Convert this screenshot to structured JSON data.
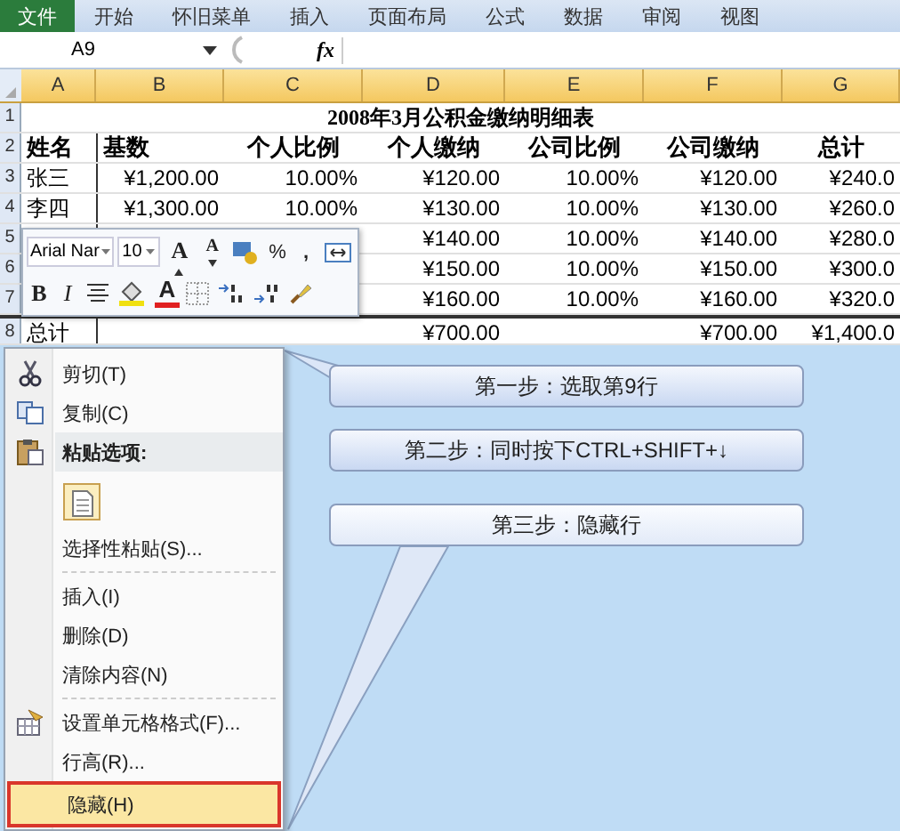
{
  "ribbon_tabs": [
    {
      "label": "文件",
      "selected": true
    },
    {
      "label": "开始",
      "selected": false
    },
    {
      "label": "怀旧菜单",
      "selected": false
    },
    {
      "label": "插入",
      "selected": false
    },
    {
      "label": "页面布局",
      "selected": false
    },
    {
      "label": "公式",
      "selected": false
    },
    {
      "label": "数据",
      "selected": false
    },
    {
      "label": "审阅",
      "selected": false
    },
    {
      "label": "视图",
      "selected": false
    }
  ],
  "formula_bar": {
    "name_box": "A9",
    "function_label": "fx"
  },
  "columns": [
    "A",
    "B",
    "C",
    "D",
    "E",
    "F",
    "G"
  ],
  "sheet": {
    "title_row": "1",
    "title": "2008年3月公积金缴纳明细表",
    "header_row": {
      "row": "2",
      "cells": [
        "姓名",
        "基数",
        "个人比例",
        "个人缴纳",
        "公司比例",
        "公司缴纳",
        "总计"
      ]
    },
    "rows": [
      {
        "row": "3",
        "kind": "data",
        "cells": [
          "张三",
          "¥1,200.00",
          "10.00%",
          "¥120.00",
          "10.00%",
          "¥120.00",
          "¥240.0"
        ]
      },
      {
        "row": "4",
        "kind": "data",
        "cells": [
          "李四",
          "¥1,300.00",
          "10.00%",
          "¥130.00",
          "10.00%",
          "¥130.00",
          "¥260.0"
        ]
      },
      {
        "row": "5",
        "kind": "data",
        "cells": [
          null,
          null,
          null,
          "¥140.00",
          "10.00%",
          "¥140.00",
          "¥280.0"
        ]
      },
      {
        "row": "6",
        "kind": "data",
        "cells": [
          null,
          null,
          null,
          "¥150.00",
          "10.00%",
          "¥150.00",
          "¥300.0"
        ]
      },
      {
        "row": "7",
        "kind": "data",
        "cells": [
          null,
          null,
          null,
          "¥160.00",
          "10.00%",
          "¥160.00",
          "¥320.0"
        ]
      },
      {
        "row": "8",
        "kind": "total",
        "cells": [
          "总计",
          null,
          null,
          "¥700.00",
          null,
          "¥700.00",
          "¥1,400.0"
        ]
      }
    ]
  },
  "mini_toolbar": {
    "font": "Arial Nar",
    "size": "10",
    "row1": [
      {
        "kind": "grow-font",
        "label": "A"
      },
      {
        "kind": "shrink-font",
        "label": "A"
      },
      {
        "kind": "currency"
      },
      {
        "kind": "percent",
        "label": "%"
      },
      {
        "kind": "comma",
        "label": ","
      },
      {
        "kind": "merge"
      }
    ],
    "row2": [
      {
        "kind": "bold",
        "label": "B"
      },
      {
        "kind": "italic",
        "label": "I"
      },
      {
        "kind": "center"
      },
      {
        "kind": "fill-color",
        "color": "#f0e010"
      },
      {
        "kind": "font-color",
        "label": "A",
        "color": "#e02020"
      },
      {
        "kind": "borders"
      },
      {
        "kind": "increase-decimal"
      },
      {
        "kind": "decrease-decimal"
      },
      {
        "kind": "format-painter"
      }
    ]
  },
  "context_menu": [
    {
      "kind": "item",
      "label": "剪切(T)",
      "selected": false
    },
    {
      "kind": "item",
      "label": "复制(C)",
      "selected": false
    },
    {
      "kind": "header",
      "label": "粘贴选项:"
    },
    {
      "kind": "paste-option"
    },
    {
      "kind": "item",
      "label": "选择性粘贴(S)...",
      "selected": false
    },
    {
      "kind": "separator"
    },
    {
      "kind": "item",
      "label": "插入(I)",
      "selected": false
    },
    {
      "kind": "item",
      "label": "删除(D)",
      "selected": false
    },
    {
      "kind": "item",
      "label": "清除内容(N)",
      "selected": false
    },
    {
      "kind": "separator"
    },
    {
      "kind": "item",
      "label": "设置单元格格式(F)...",
      "selected": false
    },
    {
      "kind": "item",
      "label": "行高(R)...",
      "selected": false
    },
    {
      "kind": "item",
      "label": "隐藏(H)",
      "selected": true
    }
  ],
  "callouts": [
    "第一步：选取第9行",
    "第二步：同时按下CTRL+SHIFT+↓",
    "第三步：隐藏行"
  ]
}
